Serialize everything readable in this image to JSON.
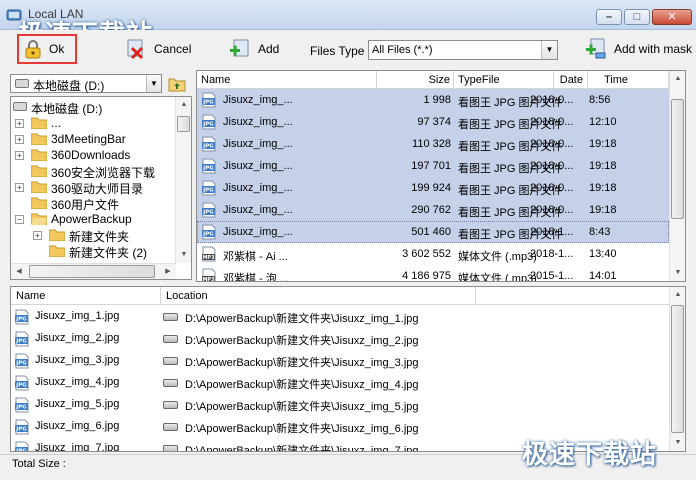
{
  "window": {
    "title": "Local LAN",
    "watermark": "极速下载站",
    "minimize_glyph": "–",
    "maximize_glyph": "□",
    "close_glyph": "✕"
  },
  "toolbar": {
    "ok_label": "Ok",
    "cancel_label": "Cancel",
    "add_label": "Add",
    "files_type_label": "Files Type",
    "files_type_value": "All Files  (*.*)",
    "add_with_mask_label": "Add with mask"
  },
  "drive_select": {
    "value": "本地磁盘 (D:)"
  },
  "tree": {
    "items": [
      {
        "label": "本地磁盘 (D:)",
        "type": "drive"
      },
      {
        "label": "...",
        "type": "folder"
      },
      {
        "label": "3dMeetingBar",
        "type": "folder"
      },
      {
        "label": "360Downloads",
        "type": "folder"
      },
      {
        "label": "360安全浏览器下载",
        "type": "folder"
      },
      {
        "label": "360驱动大师目录",
        "type": "folder"
      },
      {
        "label": "360用户文件",
        "type": "folder"
      },
      {
        "label": "ApowerBackup",
        "type": "folder-open"
      },
      {
        "label": "新建文件夹",
        "type": "subfolder"
      },
      {
        "label": "新建文件夹 (2)",
        "type": "subfolder"
      }
    ]
  },
  "filelist": {
    "columns": {
      "name": "Name",
      "size": "Size",
      "type": "TypeFile",
      "date": "Date",
      "time": "Time"
    },
    "rows": [
      {
        "name": "Jisuxz_img_...",
        "size": "1 998",
        "type": "看图王 JPG 图片文件",
        "date": "2018-0...",
        "time": "8:56",
        "icon": "jpg",
        "selected": true
      },
      {
        "name": "Jisuxz_img_...",
        "size": "97 374",
        "type": "看图王 JPG 图片文件",
        "date": "2018-0...",
        "time": "12:10",
        "icon": "jpg",
        "selected": true
      },
      {
        "name": "Jisuxz_img_...",
        "size": "110 328",
        "type": "看图王 JPG 图片文件",
        "date": "2018-0...",
        "time": "19:18",
        "icon": "jpg",
        "selected": true
      },
      {
        "name": "Jisuxz_img_...",
        "size": "197 701",
        "type": "看图王 JPG 图片文件",
        "date": "2018-0...",
        "time": "19:18",
        "icon": "jpg",
        "selected": true
      },
      {
        "name": "Jisuxz_img_...",
        "size": "199 924",
        "type": "看图王 JPG 图片文件",
        "date": "2018-0...",
        "time": "19:18",
        "icon": "jpg",
        "selected": true
      },
      {
        "name": "Jisuxz_img_...",
        "size": "290 762",
        "type": "看图王 JPG 图片文件",
        "date": "2018-0...",
        "time": "19:18",
        "icon": "jpg",
        "selected": true
      },
      {
        "name": "Jisuxz_img_...",
        "size": "501 460",
        "type": "看图王 JPG 图片文件",
        "date": "2018-1...",
        "time": "8:43",
        "icon": "jpg",
        "selected": true,
        "focused": true
      },
      {
        "name": "邓紫棋 - Ai ...",
        "size": "3 602 552",
        "type": "媒体文件 (.mp3)",
        "date": "2018-1...",
        "time": "13:40",
        "icon": "mp3",
        "selected": false
      },
      {
        "name": "邓紫棋 - 泡 ...",
        "size": "4 186 975",
        "type": "媒体文件 (.mp3)",
        "date": "2015-1...",
        "time": "14:01",
        "icon": "mp3",
        "selected": false
      }
    ]
  },
  "selected_list": {
    "columns": {
      "name": "Name",
      "location": "Location"
    },
    "rows": [
      {
        "name": "Jisuxz_img_1.jpg",
        "location": "D:\\ApowerBackup\\新建文件夹\\Jisuxz_img_1.jpg"
      },
      {
        "name": "Jisuxz_img_2.jpg",
        "location": "D:\\ApowerBackup\\新建文件夹\\Jisuxz_img_2.jpg"
      },
      {
        "name": "Jisuxz_img_3.jpg",
        "location": "D:\\ApowerBackup\\新建文件夹\\Jisuxz_img_3.jpg"
      },
      {
        "name": "Jisuxz_img_4.jpg",
        "location": "D:\\ApowerBackup\\新建文件夹\\Jisuxz_img_4.jpg"
      },
      {
        "name": "Jisuxz_img_5.jpg",
        "location": "D:\\ApowerBackup\\新建文件夹\\Jisuxz_img_5.jpg"
      },
      {
        "name": "Jisuxz_img_6.jpg",
        "location": "D:\\ApowerBackup\\新建文件夹\\Jisuxz_img_6.jpg"
      },
      {
        "name": "Jisuxz_img_7.jpg",
        "location": "D:\\ApowerBackup\\新建文件夹\\Jisuxz_img_7.jpg"
      }
    ]
  },
  "status": {
    "total_size_label": "Total Size :"
  },
  "colors": {
    "selection": "#c5d1e8",
    "ok_highlight": "#e53935",
    "jpg_badge": "#3b7ac4"
  }
}
